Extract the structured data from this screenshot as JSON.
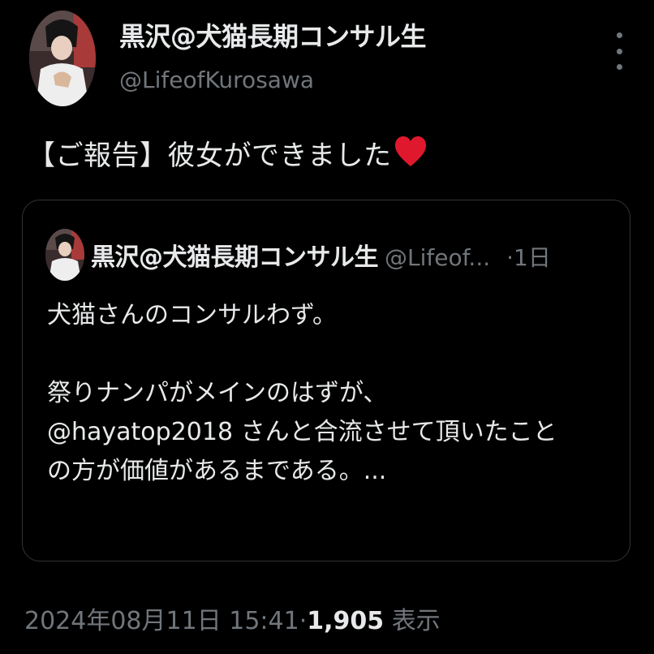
{
  "author": {
    "display_name": "黒沢@犬猫長期コンサル生",
    "handle": "@LifeofKurosawa"
  },
  "tweet": {
    "text": "【ご報告】彼女ができました",
    "emoji_icon": "heart-icon"
  },
  "quoted_tweet": {
    "display_name": "黒沢@犬猫長期コンサル生",
    "handle": "@Lifeof...",
    "separator": "·",
    "time": "1日",
    "lines": [
      "犬猫さんのコンサルわず。",
      "",
      "祭りナンパがメインのはずが、",
      "@hayatop2018 さんと合流させて頂いたこと",
      "の方が価値があるまである。..."
    ]
  },
  "meta": {
    "timestamp": "2024年08月11日 15:41",
    "separator": "·",
    "views_count": "1,905",
    "views_label": "表示"
  },
  "colors": {
    "background": "#000000",
    "primary_text": "#e7e9ea",
    "secondary_text": "#71767b",
    "border": "#2f3336",
    "heart": "#e0182d"
  }
}
